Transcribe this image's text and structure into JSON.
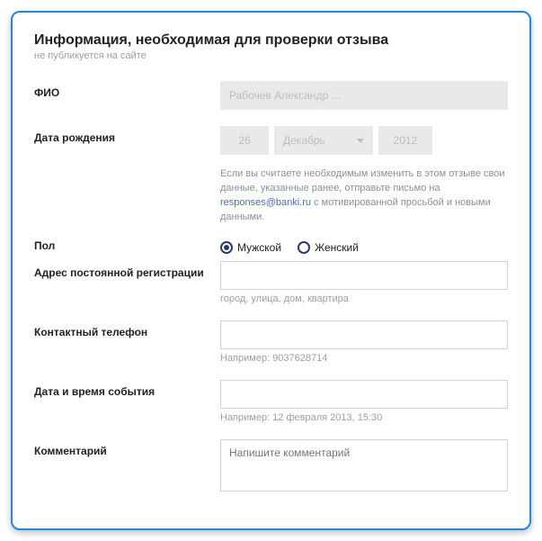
{
  "header": {
    "title": "Информация, необходимая для проверки отзыва",
    "subtitle": "не публикуется на сайте"
  },
  "fio": {
    "label": "ФИО",
    "value": "Рабочев Александр ..."
  },
  "dob": {
    "label": "Дата рождения",
    "day": "26",
    "month": "Декабрь",
    "year": "2012"
  },
  "notice": {
    "part1": "Если вы считаете необходимым изменить в этом отзыве свои данные, указанные ранее, отправьте письмо на ",
    "link": "responses@banki.ru",
    "part2": " с мотивированной просьбой и новыми данными."
  },
  "gender": {
    "label": "Пол",
    "male": "Мужской",
    "female": "Женский"
  },
  "address": {
    "label": "Адрес постоянной регистрации",
    "hint": "город, улица, дом, квартира"
  },
  "phone": {
    "label": "Контактный телефон",
    "hint": "Например: 9037628714"
  },
  "datetime": {
    "label": "Дата и время события",
    "hint": "Например: 12 февраля 2013, 15:30"
  },
  "comment": {
    "label": "Комментарий",
    "placeholder": "Напишите комментарий"
  }
}
